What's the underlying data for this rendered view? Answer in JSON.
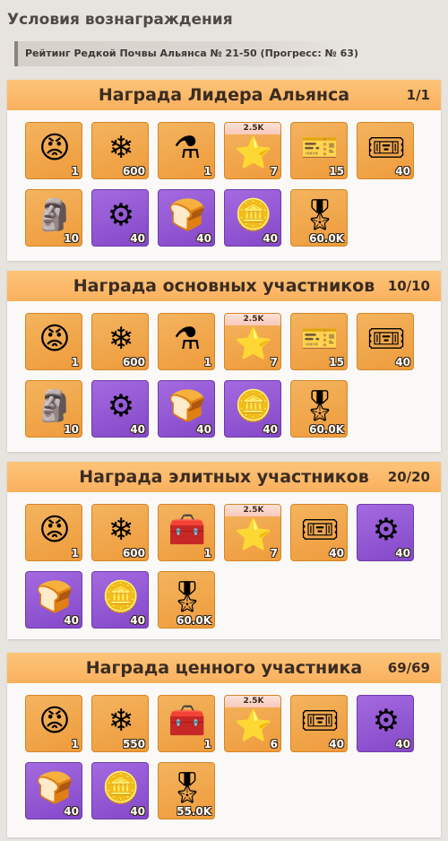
{
  "page": {
    "title": "Условия вознаграждения"
  },
  "banner": {
    "text": "Рейтинг Редкой Почвы Альянса № 21-50 (Прогресс:   № 63)"
  },
  "icons": {
    "emote": "😡",
    "star_badge": "❄",
    "potion": "⚗",
    "chest": "🧰",
    "medal": "⭐",
    "pink_ticket": "🎫",
    "gold_ticket": "🎟",
    "tablet": "🗿",
    "steel_crate": "⚙",
    "food_crate": "🍞",
    "gold_crate": "🪙",
    "honor_medal": "🎖"
  },
  "panels": [
    {
      "title": "Награда Лидера Альянса",
      "count": "1/1",
      "items": [
        {
          "icon": "emote",
          "bg": "orange",
          "qty": "1"
        },
        {
          "icon": "star_badge",
          "bg": "orange",
          "qty": "600"
        },
        {
          "icon": "potion",
          "bg": "orange",
          "qty": "1"
        },
        {
          "icon": "medal",
          "bg": "orange",
          "qty": "7",
          "badge": "2.5K"
        },
        {
          "icon": "pink_ticket",
          "bg": "orange",
          "qty": "15"
        },
        {
          "icon": "gold_ticket",
          "bg": "orange",
          "qty": "40"
        },
        {
          "icon": "tablet",
          "bg": "orange",
          "qty": "10"
        },
        {
          "icon": "steel_crate",
          "bg": "purple",
          "qty": "40"
        },
        {
          "icon": "food_crate",
          "bg": "purple",
          "qty": "40"
        },
        {
          "icon": "gold_crate",
          "bg": "purple",
          "qty": "40"
        },
        {
          "icon": "honor_medal",
          "bg": "orange",
          "qty": "60.0K"
        }
      ]
    },
    {
      "title": "Награда основных участников",
      "count": "10/10",
      "items": [
        {
          "icon": "emote",
          "bg": "orange",
          "qty": "1"
        },
        {
          "icon": "star_badge",
          "bg": "orange",
          "qty": "600"
        },
        {
          "icon": "potion",
          "bg": "orange",
          "qty": "1"
        },
        {
          "icon": "medal",
          "bg": "orange",
          "qty": "7",
          "badge": "2.5K"
        },
        {
          "icon": "pink_ticket",
          "bg": "orange",
          "qty": "15"
        },
        {
          "icon": "gold_ticket",
          "bg": "orange",
          "qty": "40"
        },
        {
          "icon": "tablet",
          "bg": "orange",
          "qty": "10"
        },
        {
          "icon": "steel_crate",
          "bg": "purple",
          "qty": "40"
        },
        {
          "icon": "food_crate",
          "bg": "purple",
          "qty": "40"
        },
        {
          "icon": "gold_crate",
          "bg": "purple",
          "qty": "40"
        },
        {
          "icon": "honor_medal",
          "bg": "orange",
          "qty": "60.0K"
        }
      ]
    },
    {
      "title": "Награда элитных участников",
      "count": "20/20",
      "items": [
        {
          "icon": "emote",
          "bg": "orange",
          "qty": "1"
        },
        {
          "icon": "star_badge",
          "bg": "orange",
          "qty": "600"
        },
        {
          "icon": "chest",
          "bg": "orange",
          "qty": "1"
        },
        {
          "icon": "medal",
          "bg": "orange",
          "qty": "7",
          "badge": "2.5K"
        },
        {
          "icon": "gold_ticket",
          "bg": "orange",
          "qty": "40"
        },
        {
          "icon": "steel_crate",
          "bg": "purple",
          "qty": "40"
        },
        {
          "icon": "food_crate",
          "bg": "purple",
          "qty": "40"
        },
        {
          "icon": "gold_crate",
          "bg": "purple",
          "qty": "40"
        },
        {
          "icon": "honor_medal",
          "bg": "orange",
          "qty": "60.0K"
        }
      ]
    },
    {
      "title": "Награда ценного участника",
      "count": "69/69",
      "items": [
        {
          "icon": "emote",
          "bg": "orange",
          "qty": "1"
        },
        {
          "icon": "star_badge",
          "bg": "orange",
          "qty": "550"
        },
        {
          "icon": "chest",
          "bg": "orange",
          "qty": "1"
        },
        {
          "icon": "medal",
          "bg": "orange",
          "qty": "6",
          "badge": "2.5K"
        },
        {
          "icon": "gold_ticket",
          "bg": "orange",
          "qty": "40"
        },
        {
          "icon": "steel_crate",
          "bg": "purple",
          "qty": "40"
        },
        {
          "icon": "food_crate",
          "bg": "purple",
          "qty": "40"
        },
        {
          "icon": "gold_crate",
          "bg": "purple",
          "qty": "40"
        },
        {
          "icon": "honor_medal",
          "bg": "orange",
          "qty": "55.0K"
        }
      ]
    }
  ]
}
